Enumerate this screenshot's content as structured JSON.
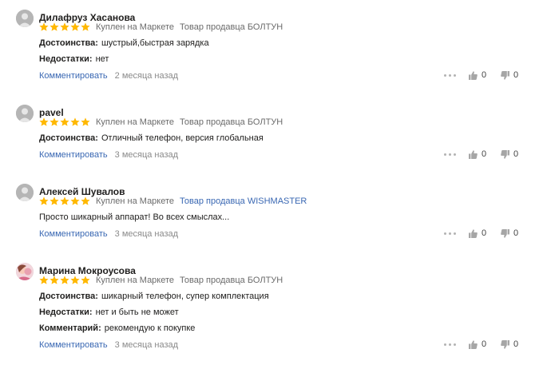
{
  "reviews": [
    {
      "author": "Дилафруз Хасанова",
      "avatar": "default",
      "rating": 5,
      "purchase": "Куплен на Маркете",
      "seller": "Товар продавца БОЛТУН",
      "seller_is_link": false,
      "lines": [
        {
          "label": "Достоинства:",
          "text": "шустрый,быстрая зарядка"
        },
        {
          "label": "Недостатки:",
          "text": "нет"
        }
      ],
      "comment_label": "Комментировать",
      "date": "2 месяца назад",
      "likes": "0",
      "dislikes": "0"
    },
    {
      "author": "pavel",
      "avatar": "default",
      "rating": 5,
      "purchase": "Куплен на Маркете",
      "seller": "Товар продавца БОЛТУН",
      "seller_is_link": false,
      "lines": [
        {
          "label": "Достоинства:",
          "text": "Отличный телефон, версия глобальная"
        }
      ],
      "comment_label": "Комментировать",
      "date": "3 месяца назад",
      "likes": "0",
      "dislikes": "0"
    },
    {
      "author": "Алексей Шувалов",
      "avatar": "default",
      "rating": 5,
      "purchase": "Куплен на Маркете",
      "seller": "Товар продавца WISHMASTER",
      "seller_is_link": true,
      "lines": [
        {
          "label": "",
          "text": "Просто шикарный аппарат! Во всех смыслах..."
        }
      ],
      "comment_label": "Комментировать",
      "date": "3 месяца назад",
      "likes": "0",
      "dislikes": "0"
    },
    {
      "author": "Марина Мокроусова",
      "avatar": "photo",
      "rating": 5,
      "purchase": "Куплен на Маркете",
      "seller": "Товар продавца БОЛТУН",
      "seller_is_link": false,
      "lines": [
        {
          "label": "Достоинства:",
          "text": "шикарный телефон, супер комплектация"
        },
        {
          "label": "Недостатки:",
          "text": "нет и быть не может"
        },
        {
          "label": "Комментарий:",
          "text": "рекомендую к покупке"
        }
      ],
      "comment_label": "Комментировать",
      "date": "3 месяца назад",
      "likes": "0",
      "dislikes": "0"
    }
  ],
  "colors": {
    "star": "#ffb800",
    "link": "#3a68b3",
    "muted": "#8a8a8a"
  }
}
